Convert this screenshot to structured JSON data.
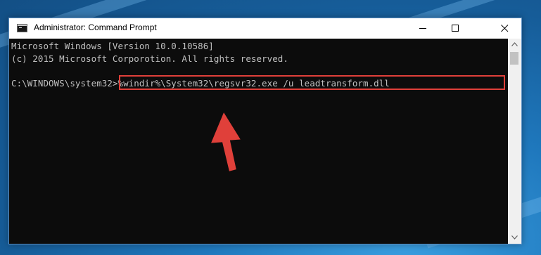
{
  "window": {
    "title": "Administrator: Command Prompt"
  },
  "titlebar_controls": {
    "minimize_icon": "minimize-icon",
    "maximize_icon": "maximize-icon",
    "close_icon": "close-icon"
  },
  "console": {
    "lines": [
      "Microsoft Windows [Version 10.0.10586]",
      "(c) 2015 Microsoft Corporotion. All rights reserved."
    ],
    "prompt": "C:\\WINDOWS\\system32>",
    "command": "%windir%\\System32\\regsvr32.exe /u leadtransform.dll"
  },
  "annotation": {
    "highlight_color": "#e0403a",
    "arrow_color": "#e0403a",
    "arrow_icon": "arrow-up-icon"
  },
  "colors": {
    "console_bg": "#0c0c0c",
    "console_text": "#c0c0c0"
  }
}
